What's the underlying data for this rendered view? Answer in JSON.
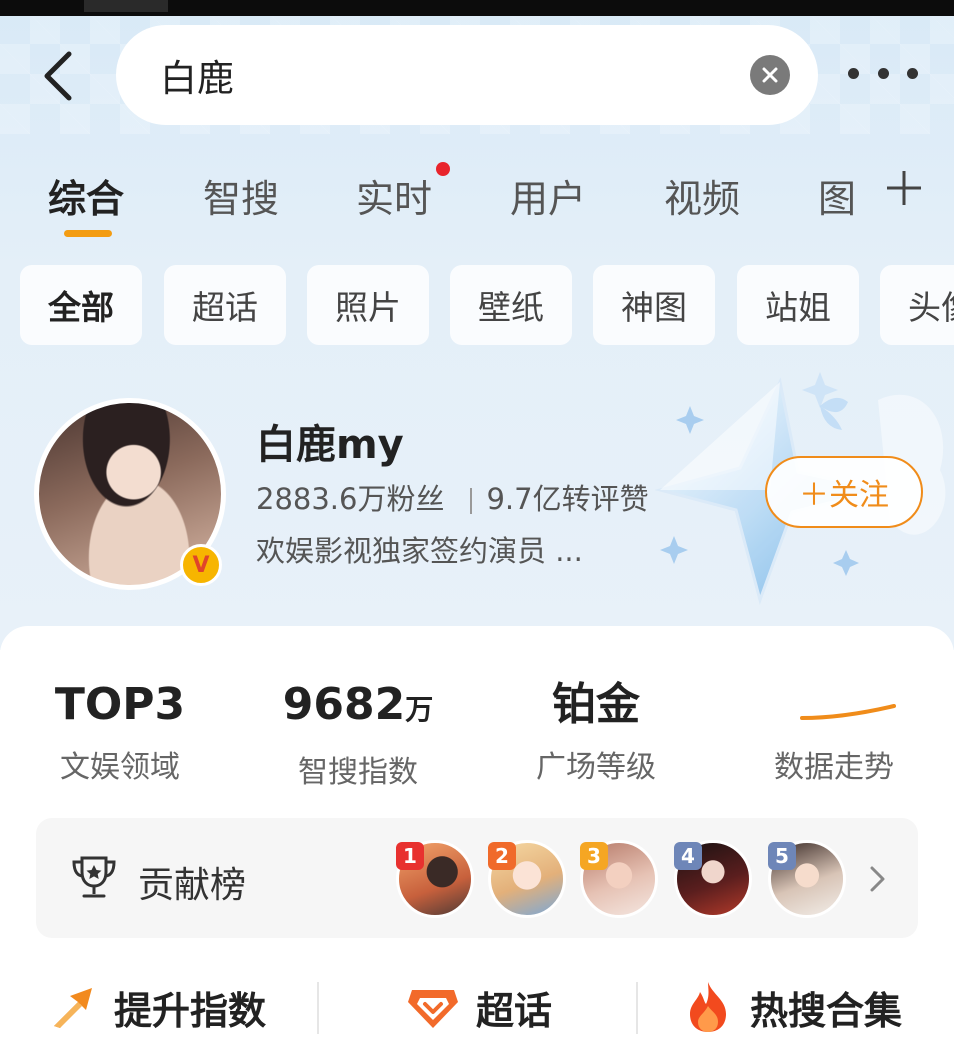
{
  "search": {
    "query": "白鹿"
  },
  "tabs": [
    {
      "label": "综合",
      "active": true
    },
    {
      "label": "智搜",
      "active": false
    },
    {
      "label": "实时",
      "active": false,
      "badge_dot": true
    },
    {
      "label": "用户",
      "active": false
    },
    {
      "label": "视频",
      "active": false
    },
    {
      "label": "图",
      "active": false
    }
  ],
  "chips": [
    {
      "label": "全部",
      "active": true
    },
    {
      "label": "超话"
    },
    {
      "label": "照片"
    },
    {
      "label": "壁纸"
    },
    {
      "label": "神图"
    },
    {
      "label": "站姐"
    },
    {
      "label": "头像"
    }
  ],
  "profile": {
    "name": "白鹿my",
    "followers": "2883.6万粉丝",
    "engagement": "9.7亿转评赞",
    "description": "欢娱影视独家签约演员 ...",
    "badge": "V",
    "follow_label": "＋关注"
  },
  "stats": [
    {
      "value": "TOP3",
      "unit": "",
      "label": "文娱领域"
    },
    {
      "value": "9682",
      "unit": "万",
      "label": "智搜指数"
    },
    {
      "value": "铂金",
      "unit": "",
      "label": "广场等级"
    },
    {
      "value": "",
      "unit": "",
      "label": "数据走势"
    }
  ],
  "contribution": {
    "title": "贡献榜",
    "ranks": [
      "1",
      "2",
      "3",
      "4",
      "5"
    ]
  },
  "bottom_actions": [
    {
      "label": "提升指数",
      "icon": "boost-arrow-icon"
    },
    {
      "label": "超话",
      "icon": "super-topic-icon"
    },
    {
      "label": "热搜合集",
      "icon": "fire-icon"
    }
  ],
  "colors": {
    "accent": "#f08c1a",
    "tab_underline": "#f39c12",
    "red_dot": "#e8242c",
    "verified": "#f7b500"
  }
}
